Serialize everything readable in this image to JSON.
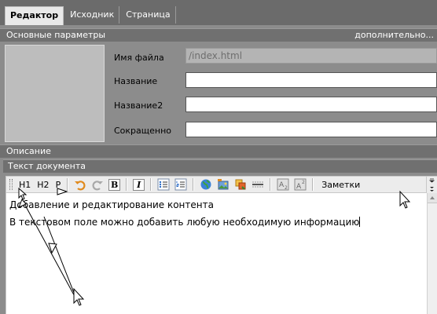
{
  "tabs": [
    {
      "label": "Редактор",
      "active": true
    },
    {
      "label": "Исходник",
      "active": false
    },
    {
      "label": "Страница",
      "active": false
    }
  ],
  "main_section": {
    "title": "Основные параметры",
    "more": "дополнительно..."
  },
  "fields": {
    "filename": {
      "label": "Имя файла",
      "value": "/index.html",
      "disabled": true
    },
    "title": {
      "label": "Название",
      "value": ""
    },
    "title2": {
      "label": "Название2",
      "value": ""
    },
    "short": {
      "label": "Сокращенно",
      "value": ""
    }
  },
  "description_section": {
    "title": "Описание"
  },
  "document_section": {
    "title": "Текст документа"
  },
  "toolbar": {
    "h1": "H1",
    "h2": "H2",
    "p": "P",
    "bold": "B",
    "italic": "I",
    "notes": "Заметки",
    "icons": [
      "undo-icon",
      "redo-icon",
      "bold-icon",
      "italic-icon",
      "bulleted-list-icon",
      "numbered-list-icon",
      "globe-link-icon",
      "insert-image-icon",
      "insert-object-icon",
      "horizontal-rule-icon",
      "subscript-icon",
      "superscript-icon"
    ]
  },
  "editor": {
    "line1": "Добавление и редактирование контента",
    "line2": "В текстовом поле можно добавить любую необходимую информацию"
  },
  "colors": {
    "panel": "#8c8c8c",
    "tabbar": "#6b6b6b",
    "section_bar": "#707070",
    "toolbar": "#ececec"
  }
}
